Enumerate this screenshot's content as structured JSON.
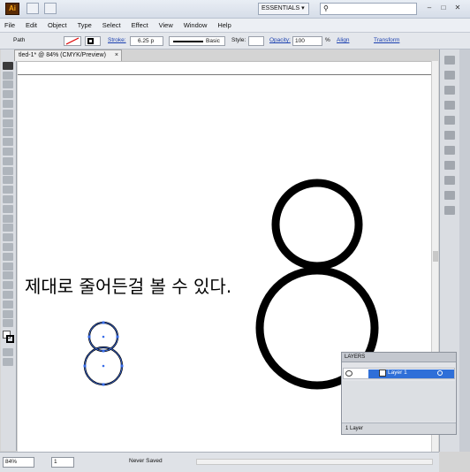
{
  "app": {
    "logo": "Ai",
    "workspace": "ESSENTIALS",
    "search_placeholder": "",
    "window_controls": [
      "–",
      "□",
      "✕"
    ]
  },
  "menu": [
    "File",
    "Edit",
    "Object",
    "Type",
    "Select",
    "Effect",
    "View",
    "Window",
    "Help"
  ],
  "control_bar": {
    "selection_type": "Path",
    "stroke_label": "Stroke:",
    "stroke_weight": "6.25 p",
    "brush": "Basic",
    "style_label": "Style:",
    "opacity_label": "Opacity:",
    "opacity_value": "100",
    "opacity_unit": "%",
    "align_label": "Align",
    "transform_label": "Transform"
  },
  "document": {
    "tab_title": "tled-1* @ 84% (CMYK/Preview)",
    "tab_close": "×"
  },
  "canvas": {
    "annotation_text": "제대로 줄어든걸 볼 수 있다."
  },
  "layers_panel": {
    "title": "LAYERS",
    "layer_name": "Layer 1",
    "layer_count": "1 Layer"
  },
  "status": {
    "zoom": "84%",
    "page": "1",
    "save_state": "Never Saved"
  },
  "colors": {
    "ui_background": "#d4d4d4",
    "selection_blue": "#2f6fd8",
    "artwork": "#000000",
    "logo_bg": "#5a2b04",
    "logo_fg": "#f6a417"
  }
}
